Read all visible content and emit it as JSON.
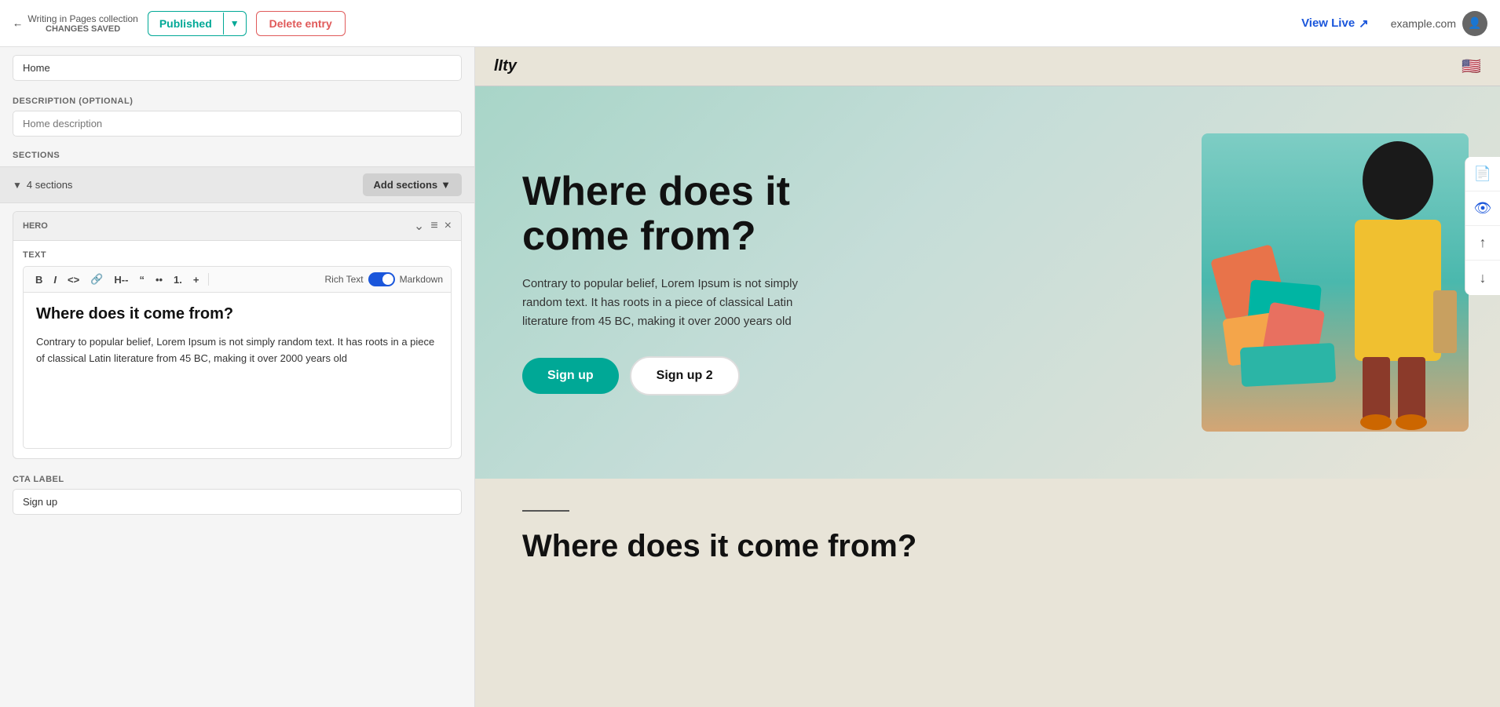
{
  "topbar": {
    "back_label": "Writing in Pages collection",
    "saved_label": "CHANGES SAVED",
    "published_label": "Published",
    "delete_label": "Delete entry",
    "view_live_label": "View Live",
    "domain": "example.com"
  },
  "left_panel": {
    "description_label": "DESCRIPTION (OPTIONAL)",
    "description_placeholder": "Home description",
    "description_value": "Home description",
    "sections_label": "SECTIONS",
    "sections_count": "4 sections",
    "add_sections_label": "Add sections",
    "hero_label": "HERO",
    "text_label": "TEXT",
    "toolbar": {
      "bold": "B",
      "italic": "I",
      "code": "<>",
      "link": "🔗",
      "heading": "H.",
      "quote": "\"",
      "ul": "≡",
      "ol": "1.",
      "plus": "+",
      "rich_text": "Rich Text",
      "markdown": "Markdown"
    },
    "editor_heading": "Where does it come from?",
    "editor_body": "Contrary to popular belief, Lorem Ipsum is not simply random text. It has roots in a piece of classical Latin literature from 45 BC, making it over 2000 years old",
    "cta_label": "CTA LABEL",
    "cta_value": "Sign up"
  },
  "preview": {
    "logo": "lIty",
    "flag_emoji": "🇺🇸",
    "hero_heading": "Where does it come from?",
    "hero_body": "Contrary to popular belief, Lorem Ipsum is not simply random text. It has roots in a piece of classical Latin literature from 45 BC, making it over 2000 years old",
    "btn1_label": "Sign up",
    "btn2_label": "Sign up 2",
    "section2_heading": "Where does it come from?"
  },
  "side_icons": {
    "doc_icon": "📄",
    "eye_icon": "👁",
    "up_icon": "↑",
    "down_icon": "↓"
  }
}
